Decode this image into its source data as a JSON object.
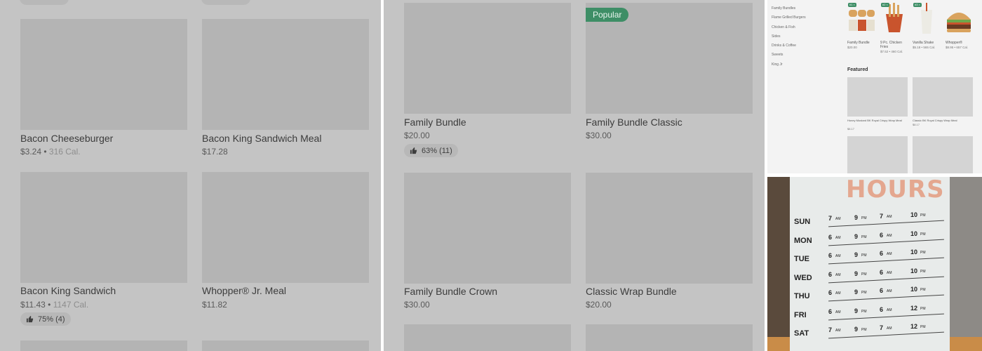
{
  "panel1": {
    "cards": [
      {
        "title": "Bacon Cheeseburger",
        "price": "$3.24",
        "sep": " • ",
        "calories": "316 Cal."
      },
      {
        "title": "Bacon King Sandwich Meal",
        "price": "$17.28"
      },
      {
        "title": "Bacon King Sandwich",
        "price": "$11.43",
        "sep": " • ",
        "calories": "1147 Cal.",
        "rating": "75% (4)"
      },
      {
        "title": "Whopper® Jr. Meal",
        "price": "$11.82"
      }
    ]
  },
  "panel2": {
    "badge": "Popular",
    "cards": [
      {
        "title": "Family Bundle",
        "price": "$20.00",
        "rating": "63% (11)"
      },
      {
        "title": "Family Bundle Classic",
        "price": "$30.00"
      },
      {
        "title": "Family Bundle Crown",
        "price": "$30.00"
      },
      {
        "title": "Classic Wrap Bundle",
        "price": "$20.00"
      }
    ]
  },
  "panel3": {
    "nav": [
      "Family Bundles",
      "Flame Grilled Burgers",
      "Chicken & Fish",
      "Sides",
      "Drinks & Coffee",
      "Sweets",
      "King Jr"
    ],
    "products": [
      {
        "tag": "#1 ×",
        "name": "Family Bundle",
        "price": "$20.00"
      },
      {
        "tag": "#2 ×",
        "name": "9 Pc. Chicken Fries",
        "price": "$7.52 • 460 Cal."
      },
      {
        "tag": "#3 ×",
        "name": "Vanilla Shake",
        "price": "$5.18 • 565 Cal."
      },
      {
        "tag": "",
        "name": "Whopper®",
        "price": "$8.95 • 657 Cal."
      }
    ],
    "featured_heading": "Featured",
    "featured": [
      {
        "name": "Honey Mustard BK Royal Crispy Wrap Meal",
        "price": "$8.17"
      },
      {
        "name": "Classic BK Royal Crispy Wrap Meal",
        "price": "$8.17"
      }
    ]
  },
  "panel4": {
    "title": "HOURS",
    "days": [
      {
        "day": "SUN",
        "d_open": "7",
        "d_close": "9",
        "w_open": "7",
        "w_close": "10"
      },
      {
        "day": "MON",
        "d_open": "6",
        "d_close": "9",
        "w_open": "6",
        "w_close": "10"
      },
      {
        "day": "TUE",
        "d_open": "6",
        "d_close": "9",
        "w_open": "6",
        "w_close": "10"
      },
      {
        "day": "WED",
        "d_open": "6",
        "d_close": "9",
        "w_open": "6",
        "w_close": "10"
      },
      {
        "day": "THU",
        "d_open": "6",
        "d_close": "9",
        "w_open": "6",
        "w_close": "10"
      },
      {
        "day": "FRI",
        "d_open": "6",
        "d_close": "9",
        "w_open": "6",
        "w_close": "12"
      },
      {
        "day": "SAT",
        "d_open": "7",
        "d_close": "9",
        "w_open": "7",
        "w_close": "12"
      }
    ],
    "am": "AM",
    "pm": "PM"
  },
  "colors": {
    "overlay": "#c4c4c4",
    "image_placeholder": "#b4b4b4",
    "badge_green": "#3e8e66",
    "sign_title": "#e4a78f"
  }
}
